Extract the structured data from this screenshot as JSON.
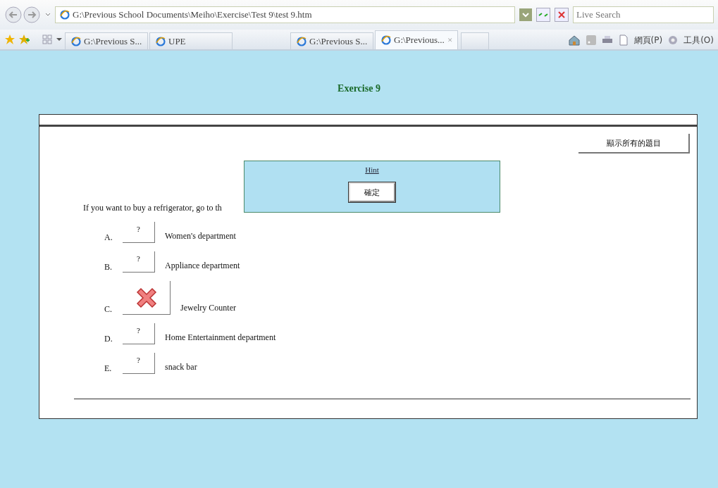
{
  "browser": {
    "address": "G:\\Previous School Documents\\Meiho\\Exercise\\Test 9\\test 9.htm",
    "search_placeholder": "Live Search",
    "tabs": [
      {
        "label": "G:\\Previous S...",
        "selected": false
      },
      {
        "label": "UPE",
        "selected": false
      },
      {
        "label": "G:\\Previous S...",
        "selected": false
      },
      {
        "label": "G:\\Previous...",
        "selected": true
      }
    ],
    "close_tab": "×",
    "menus": [
      "網頁(P)",
      "工具(O)"
    ]
  },
  "page": {
    "title": "Exercise 9",
    "show_all_button": "顯示所有的題目",
    "question": "If you want to buy a refrigerator, go to th",
    "options": [
      {
        "letter": "A.",
        "kind": "unanswered",
        "mark": "?",
        "text": "Women's department"
      },
      {
        "letter": "B.",
        "kind": "unanswered",
        "mark": "?",
        "text": "Appliance department"
      },
      {
        "letter": "C.",
        "kind": "wrong",
        "text": "Jewelry Counter"
      },
      {
        "letter": "D.",
        "kind": "unanswered",
        "mark": "?",
        "text": "Home Entertainment department"
      },
      {
        "letter": "E.",
        "kind": "unanswered",
        "mark": "?",
        "text": "snack bar"
      }
    ]
  },
  "dialog": {
    "link": "Hint",
    "ok_button": "確定"
  }
}
